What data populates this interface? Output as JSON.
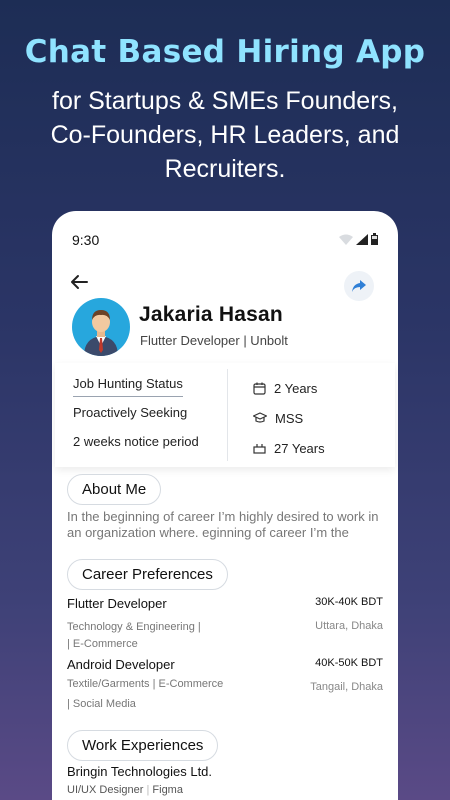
{
  "headline": "Chat Based Hiring App",
  "subheadline": [
    "for Startups & SMEs Founders,",
    "Co-Founders, HR Leaders, and",
    "Recruiters."
  ],
  "status_bar": {
    "time": "9:30"
  },
  "profile": {
    "name": "Jakaria Hasan",
    "role": "Flutter Developer | Unbolt"
  },
  "info": {
    "status_label": "Job Hunting Status",
    "status_value": "Proactively Seeking",
    "notice": "2 weeks notice period",
    "experience": "2 Years",
    "degree": "MSS",
    "age": "27 Years"
  },
  "about": {
    "heading": "About Me",
    "text": "In the beginning of career I’m highly desired to work in an organization where. eginning of career I’m the"
  },
  "career": {
    "heading": "Career Preferences",
    "items": [
      {
        "title": "Flutter Developer",
        "salary": "30K-40K BDT",
        "tags_line1": "Technology & Engineering |",
        "tags_line2": "| E-Commerce",
        "location": "Uttara, Dhaka"
      },
      {
        "title": "Android Developer",
        "salary": "40K-50K BDT",
        "tags_line1": "Textile/Garments | E-Commerce",
        "tags_line2": "| Social Media",
        "location": "Tangail, Dhaka"
      }
    ]
  },
  "work": {
    "heading": "Work Experiences",
    "company": "Bringin Technologies Ltd.",
    "position": "UI/UX Designer",
    "tool": "Figma"
  },
  "colors": {
    "headline": "#8fe3ff",
    "avatar_bg": "#27a7dd",
    "share_icon": "#2f7fd6"
  }
}
